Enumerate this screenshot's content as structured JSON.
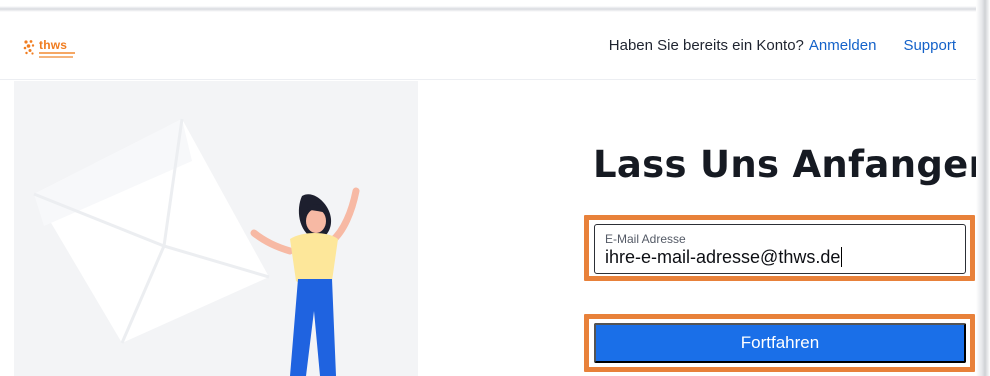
{
  "header": {
    "logo_text": "thws",
    "account_prompt": "Haben Sie bereits ein Konto?",
    "login_label": "Anmelden",
    "support_label": "Support"
  },
  "main": {
    "heading": "Lass Uns Anfangen",
    "email_field": {
      "label": "E-Mail Adresse",
      "value": "ihre-e-mail-adresse@thws.de"
    },
    "continue_button": "Fortfahren"
  },
  "colors": {
    "brand_orange": "#f07c1f",
    "link_blue": "#1462c9",
    "button_blue": "#1a6fe8",
    "highlight_orange": "#e8813a"
  }
}
